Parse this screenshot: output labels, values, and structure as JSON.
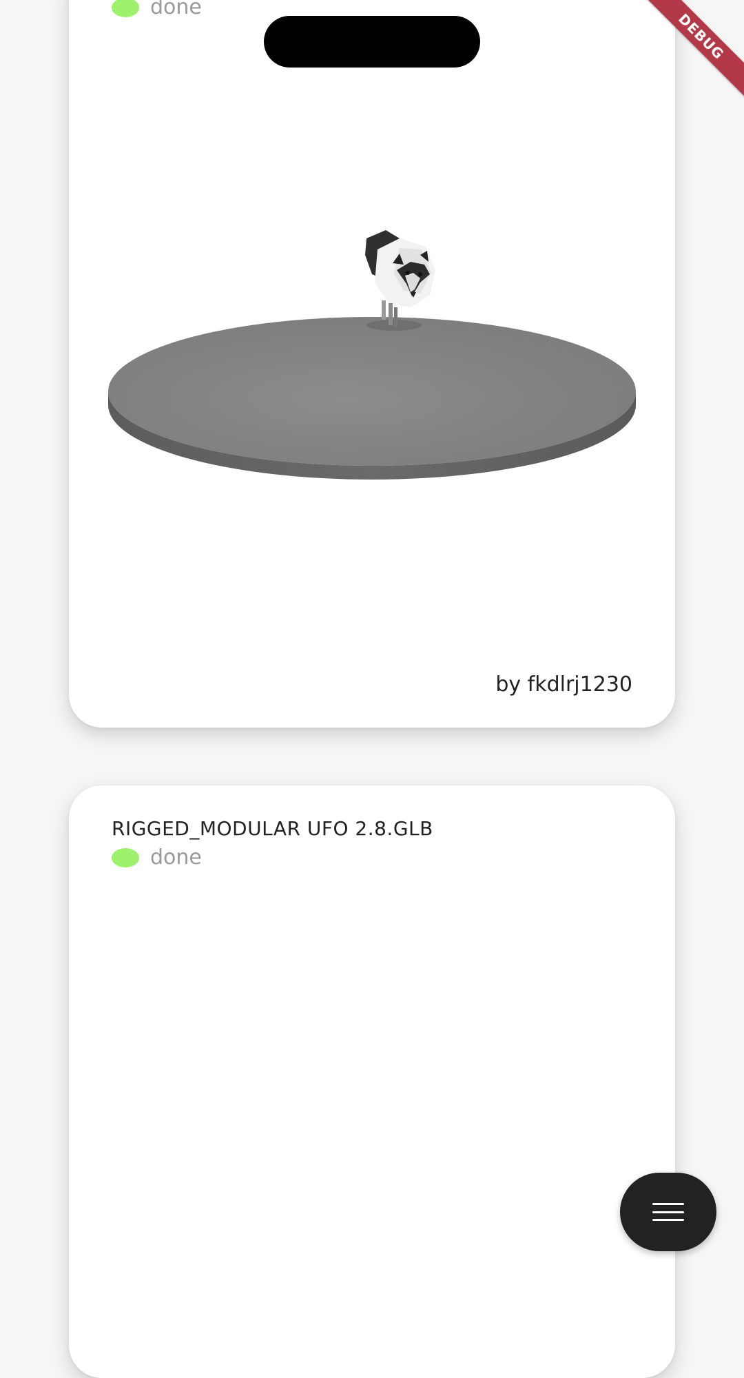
{
  "colors": {
    "status_done": "#9df16d",
    "debug_ribbon": "#b23a48",
    "fab_background": "#222222"
  },
  "cards": [
    {
      "status": "done",
      "author": "by fkdlrj1230",
      "viewer_content": "husky-dog-3d-model"
    },
    {
      "title": "RIGGED_MODULAR UFO 2.8.GLB",
      "status": "done"
    }
  ],
  "debug_banner": "DEBUG",
  "fab": {
    "icon": "menu-icon"
  }
}
